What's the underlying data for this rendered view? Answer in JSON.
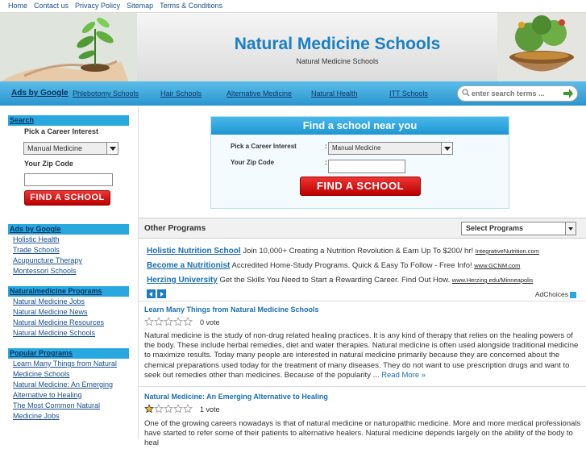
{
  "topnav": [
    "Home",
    "Contact us",
    "Privacy Policy",
    "Sitemap",
    "Terms & Conditions"
  ],
  "header": {
    "title": "Natural Medicine Schools",
    "subtitle": "Natural Medicine Schools"
  },
  "menu": {
    "ads": "Ads by Google",
    "items": [
      "Phlebotomy Schools",
      "Hair Schools",
      "Alternative Medicine",
      "Natural Health",
      "ITT Schools"
    ]
  },
  "search": {
    "placeholder": "enter search terms ..."
  },
  "sidebar": {
    "search_head": "Search",
    "career_label": "Pick a Career Interest",
    "career_value": "Manual Medicine",
    "zip_label": "Your Zip Code",
    "find_button": "FIND A SCHOOL",
    "ads_head": "Ads by Google",
    "ads_links": [
      "Holistic Health",
      "Trade Schools",
      "Acupuncture Therapy",
      "Montessori Schools"
    ],
    "programs_head": "Naturalmedicine Programs",
    "programs_links": [
      "Natural Medicine Jobs",
      "Natural Medicine News",
      "Natural Medicine Resources",
      "Natural Medicine Schools"
    ],
    "popular_head": "Popular Programs",
    "popular_links": [
      "Learn Many Things from Natural Medicine Schools",
      "Natural Medicine: An Emerging Alternative to Healing",
      "The Most Common Natural Medicine Jobs"
    ]
  },
  "finder": {
    "title": "Find a school near you",
    "career_label": "Pick a Career Interest",
    "career_value": "Manual Medicine",
    "zip_label": "Your Zip Code",
    "colon": ":",
    "button": "FIND A SCHOOL"
  },
  "other": {
    "title": "Other Programs",
    "select": "Select Programs",
    "ads": [
      {
        "title": "Holistic Nutrition School",
        "text": "Join 10,000+ Creating a Nutrition Revolution & Earn Up To $200/ hr!",
        "url": "IntegrativeNutrition.com"
      },
      {
        "title": "Become a Nutritionist",
        "text": "Accredited Home-Study Programs. Quick & Easy To Follow - Free Info!",
        "url": "www.GCNM.com"
      },
      {
        "title": "Herzing University",
        "text": "Get the Skills You Need to Start a Rewarding Career. Find Out How.",
        "url": "www.Herzing.edu/Minneapolis"
      }
    ],
    "adchoices": "AdChoices"
  },
  "articles": [
    {
      "title": "Learn Many Things from Natural Medicine Schools",
      "votes": "0 vote",
      "rating": 0,
      "body": "Natural medicine is the study of non-drug related healing practices. It is any kind of therapy that relies on the healing powers of the body. These include herbal remedies, diet and water therapies. Natural medicine is often used alongside traditional medicine to maximize results. Today many people are interested in natural medicine primarily because they are concerned about the chemical preparations used today for the treatment of many diseases. They do not want to use prescription drugs and want to seek out remedies other than medicines. Because of the popularity ...",
      "more": "Read More »"
    },
    {
      "title": "Natural Medicine: An Emerging Alternative to Healing",
      "votes": "1 vote",
      "rating": 1,
      "body": "One of the growing careers nowadays is that of natural medicine or naturopathic medicine. More and more medical professionals have started to refer some of their patients to alternative healers. Natural medicine depends largely on the ability of the body to heal",
      "more": ""
    }
  ],
  "colors": {
    "accent": "#29a8e0",
    "title": "#1b7fc4",
    "button": "#cc1111"
  }
}
